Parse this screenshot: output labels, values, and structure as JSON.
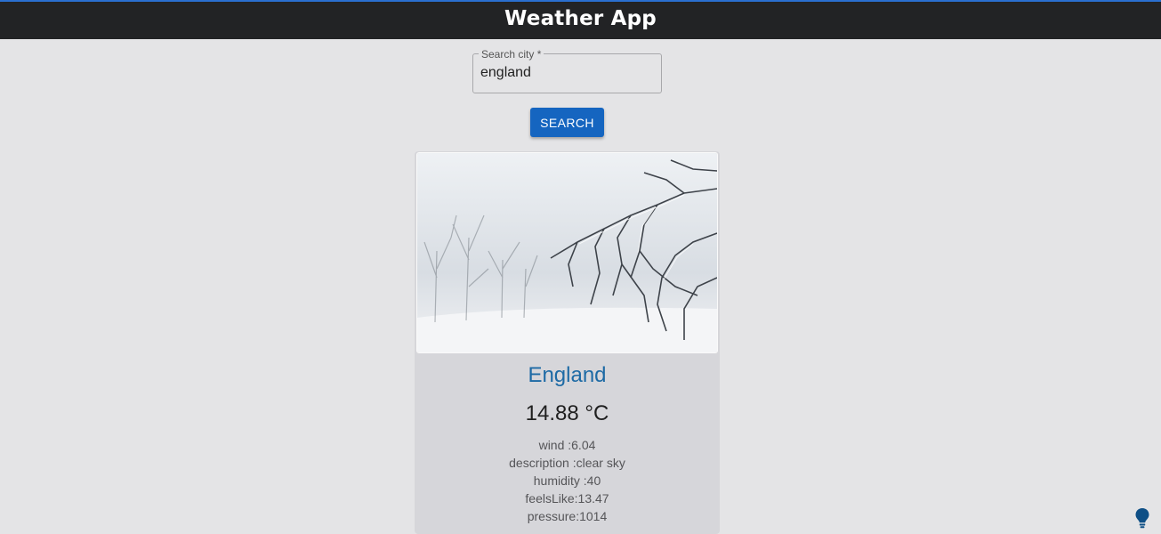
{
  "header": {
    "title": "Weather App"
  },
  "search": {
    "label": "Search city *",
    "value": "england",
    "button_label": "SEARCH"
  },
  "card": {
    "image_name": "frosted-branches-photo",
    "city": "England",
    "temperature": "14.88 °C",
    "details": {
      "wind": "wind :6.04",
      "description": "description :clear sky",
      "humidity": "humidity :40",
      "feels_like": "feelsLike:13.47",
      "pressure": "pressure:1014"
    }
  },
  "icons": {
    "bulb": "lightbulb-icon"
  },
  "colors": {
    "accent": "#1565c0",
    "city": "#1d6aa5",
    "header_bg": "#222325",
    "page_bg": "#e4e4e6"
  }
}
